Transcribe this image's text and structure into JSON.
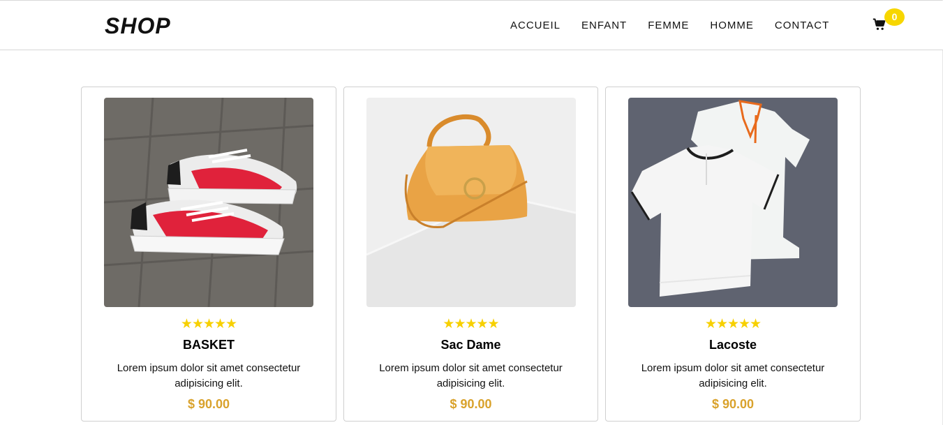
{
  "brand": {
    "logo": "SHOP"
  },
  "nav": {
    "items": [
      {
        "label": "ACCUEIL"
      },
      {
        "label": "ENFANT"
      },
      {
        "label": "FEMME"
      },
      {
        "label": "HOMME"
      },
      {
        "label": "CONTACT"
      }
    ]
  },
  "cart": {
    "icon": "cart-icon",
    "count": "0",
    "badge_color": "#f7d600"
  },
  "products": [
    {
      "image": "sneakers-image",
      "rating": 5,
      "stars": "★★★★★",
      "name": "BASKET",
      "description": "Lorem ipsum dolor sit amet consectetur adipisicing elit.",
      "price": "$ 90.00"
    },
    {
      "image": "handbag-image",
      "rating": 5,
      "stars": "★★★★★",
      "name": "Sac Dame",
      "description": "Lorem ipsum dolor sit amet consectetur adipisicing elit.",
      "price": "$ 90.00"
    },
    {
      "image": "polo-shirts-image",
      "rating": 5,
      "stars": "★★★★★",
      "name": "Lacoste",
      "description": "Lorem ipsum dolor sit amet consectetur adipisicing elit.",
      "price": "$ 90.00"
    }
  ],
  "colors": {
    "star": "#f7d000",
    "price": "#d9a22c"
  }
}
